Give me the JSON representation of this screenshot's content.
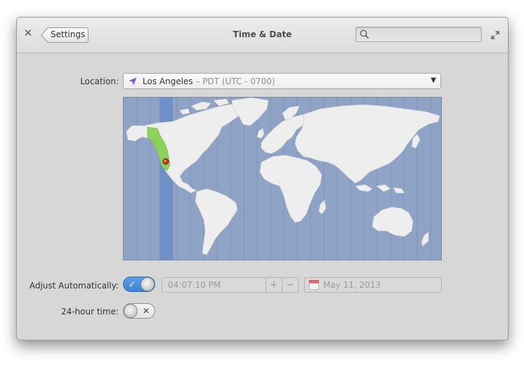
{
  "titlebar": {
    "back_label": "Settings",
    "title": "Time & Date",
    "search_placeholder": ""
  },
  "location": {
    "label": "Location:",
    "city": "Los Angeles",
    "separator": " – ",
    "timezone": "PDT (UTC - 0700)"
  },
  "adjust": {
    "label": "Adjust Automatically:",
    "enabled": true,
    "time": "04:07:10 PM",
    "increment_label": "+",
    "decrement_label": "−",
    "date": "May 11, 2013"
  },
  "hour24": {
    "label": "24-hour time:",
    "enabled": false
  },
  "colors": {
    "accent": "#3f84d2",
    "map_ocean": "#8fa3c6",
    "map_land": "#efeeee",
    "timezone_band": "#6f8fc7",
    "timezone_region": "#8cd25a",
    "pin": "#d9342b"
  },
  "icons": {
    "close": "close-icon",
    "search": "search-icon",
    "maximize": "maximize-icon",
    "location": "location-arrow-icon",
    "dropdown": "triangle-down-icon",
    "calendar": "calendar-icon"
  }
}
